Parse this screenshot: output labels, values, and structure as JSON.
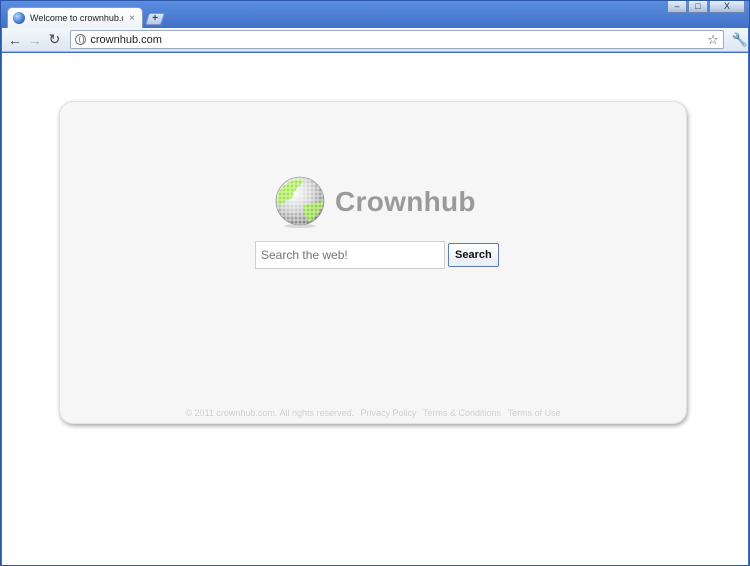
{
  "browser": {
    "tab_title": "Welcome to crownhub.com",
    "tab_close": "×",
    "newtab_label": "+",
    "address": "crownhub.com",
    "window_buttons": {
      "minimize": "–",
      "maximize": "□",
      "close": "X"
    },
    "back": "←",
    "forward": "→",
    "reload": "↻",
    "star": "☆",
    "wrench": "🔧"
  },
  "page": {
    "brand_name": "Crownhub",
    "search_placeholder": "Search the web!",
    "search_button": "Search",
    "footer": {
      "copyright": "© 2011 crownhub.com. All rights reserved.",
      "links": [
        "Privacy Policy",
        "Terms & Conditions",
        "Terms of Use"
      ]
    }
  },
  "colors": {
    "card_bg": "#f6f6f6",
    "brand_gray": "#9a9a9a",
    "globe_green": "#9be83a"
  }
}
